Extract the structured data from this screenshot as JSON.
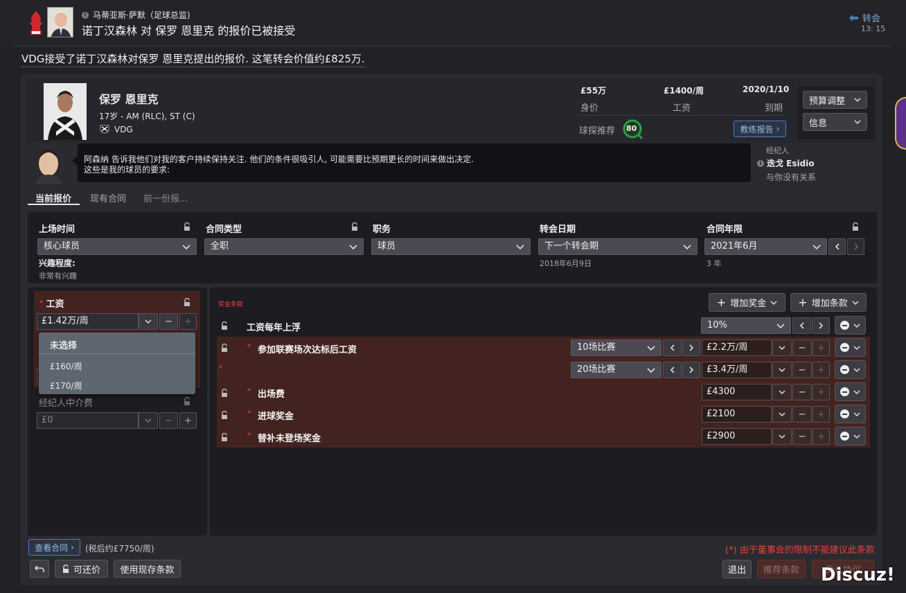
{
  "header": {
    "sender_name": "马蒂亚斯·萨默（足球总监)",
    "title": "诺丁汉森林 对 保罗 恩里克 的报价已被接受",
    "category": "转会",
    "time": "13: 15"
  },
  "message": "VDG接受了诺丁汉森林对保罗 恩里克提出的报价. 这笔转会价值约£825万.",
  "player": {
    "name": "保罗 恩里克",
    "age_pos": "17岁 - AM (RLC), ST (C)",
    "club": "VDG",
    "value": "£55万",
    "value_label": "身价",
    "wage": "£1400/周",
    "wage_label": "工资",
    "expiry": "2020/1/10",
    "expiry_label": "到期",
    "scout_label": "球探推荐",
    "scout_score": "80",
    "coach_report": "教练报告",
    "budget_btn": "预算调整",
    "info_btn": "信息"
  },
  "agent_msg": {
    "line1": "阿森纳 告诉我他们对我的客户持续保持关注. 他们的条件很吸引人, 可能需要比预期更长的时间来做出决定.",
    "line2": "这些是我的球员的要求:",
    "agent_title": "经纪人",
    "agent_name": "迭戈 Esidio",
    "agent_rel": "与你没有关系"
  },
  "tabs": [
    "当前报价",
    "现有合同",
    "前一份报..."
  ],
  "terms": {
    "playing_time_label": "上场时间",
    "playing_time": "核心球员",
    "contract_type_label": "合同类型",
    "contract_type": "全职",
    "role_label": "职务",
    "role": "球员",
    "transfer_date_label": "转会日期",
    "transfer_date": "下一个转会期",
    "transfer_date_sub": "2018年6月9日",
    "contract_len_label": "合同年限",
    "contract_len": "2021年6月",
    "contract_len_sub": "3 年",
    "interest_label": "兴趣程度:",
    "interest": "非常有兴趣"
  },
  "wage_box": {
    "label": "工资",
    "value": "£1.42万/周",
    "dropdown_options": [
      "未选择",
      "£160/周",
      "£170/周"
    ],
    "agent_fee_label": "经纪人中介费",
    "agent_fee": "£0"
  },
  "bonus": {
    "section_label": "奖金条款",
    "add_bonus": "增加奖金",
    "add_clause": "增加条款",
    "rows": [
      {
        "label": "工资每年上浮",
        "value": "10%",
        "red": false,
        "star": false
      },
      {
        "label": "参加联赛场次达标后工资",
        "cond": "10场比赛",
        "value": "£2.2万/周",
        "red": true,
        "star": true
      },
      {
        "label": "",
        "cond": "20场比赛",
        "value": "£3.4万/周",
        "red": true,
        "star": true
      },
      {
        "label": "出场费",
        "value": "£4300",
        "red": true,
        "star": true
      },
      {
        "label": "进球奖金",
        "value": "£2100",
        "red": true,
        "star": true
      },
      {
        "label": "替补未登场奖金",
        "value": "£2900",
        "red": true,
        "star": true
      }
    ]
  },
  "footer": {
    "view_contract": "查看合同",
    "after_tax": "(税后约£7750/周)",
    "negotiable": "可还价",
    "use_existing": "使用现存条款",
    "board_notice": "(*) 由于董事会的限制不能建议此条款",
    "exit": "退出",
    "recommend": "推荐条款",
    "confirm": "确认协议",
    "watermark": "Discuz!"
  },
  "colors": {
    "accent_blue": "#6fa8dc",
    "warn_red": "#e2443a",
    "panel_red": "#43231f",
    "scout_green": "#2e9e4a"
  }
}
